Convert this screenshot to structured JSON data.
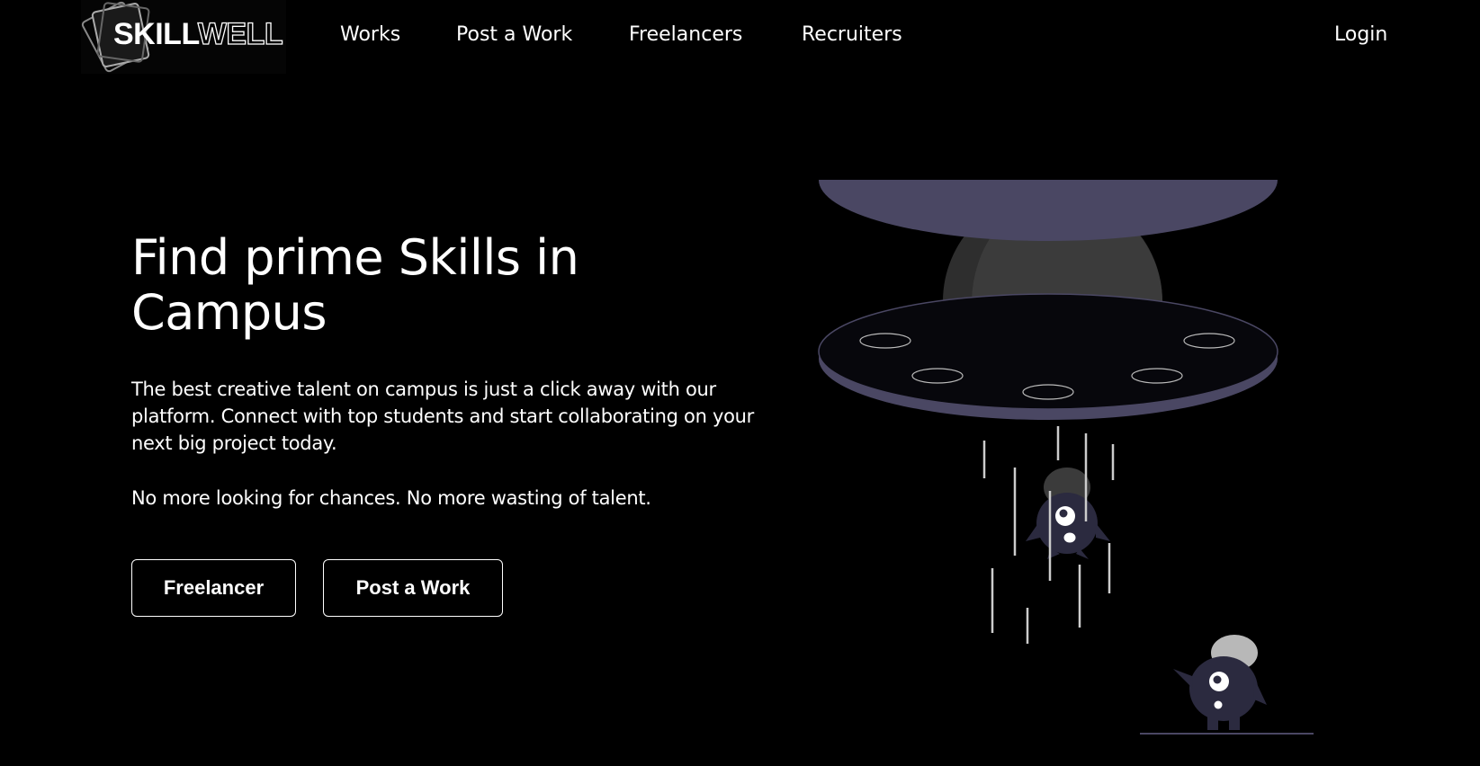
{
  "brand": {
    "name_part1": "SKILL",
    "name_part2": "WELL"
  },
  "nav": {
    "links": [
      "Works",
      "Post a Work",
      "Freelancers",
      "Recruiters"
    ],
    "login": "Login"
  },
  "hero": {
    "title": "Find prime Skills in Campus",
    "description": "The best creative talent on campus is just a click away with our platform. Connect with top students and start collaborating on your next big project today.",
    "tagline": "No more looking for chances. No more wasting of talent.",
    "buttons": {
      "freelancer": "Freelancer",
      "post_work": "Post a Work"
    }
  },
  "colors": {
    "background": "#000000",
    "text": "#ffffff",
    "ufo_body": "#0a0a12",
    "ufo_rim": "#4a4763",
    "dome": "#3a3a3a",
    "alien": "#2b2a3f"
  }
}
